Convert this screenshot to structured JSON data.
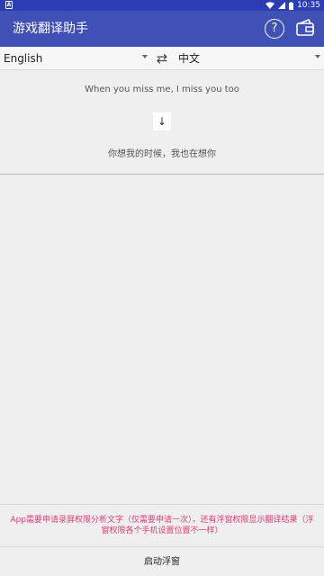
{
  "status": {
    "left_icon": "A",
    "time": "10:35"
  },
  "app_bar": {
    "title": "游戏翻译助手",
    "help_label": "?"
  },
  "lang": {
    "source": "English",
    "target": "中文"
  },
  "translation": {
    "source_text": "When you miss me, I miss you too",
    "arrow": "↓",
    "target_text": "你想我的时候，我也在想你"
  },
  "notice": {
    "line1": "App需要申请录屏权限分析文字（仅需要申请一次），还有浮窗权限显示翻译结果（浮",
    "line2": "窗权限各个手机设置位置不一样）"
  },
  "bottom": {
    "start_label": "启动浮窗"
  },
  "colors": {
    "status_bar": "#2b3cb5",
    "app_bar": "#3f51b5",
    "notice_text": "#e53b7a",
    "background": "#efefef"
  }
}
